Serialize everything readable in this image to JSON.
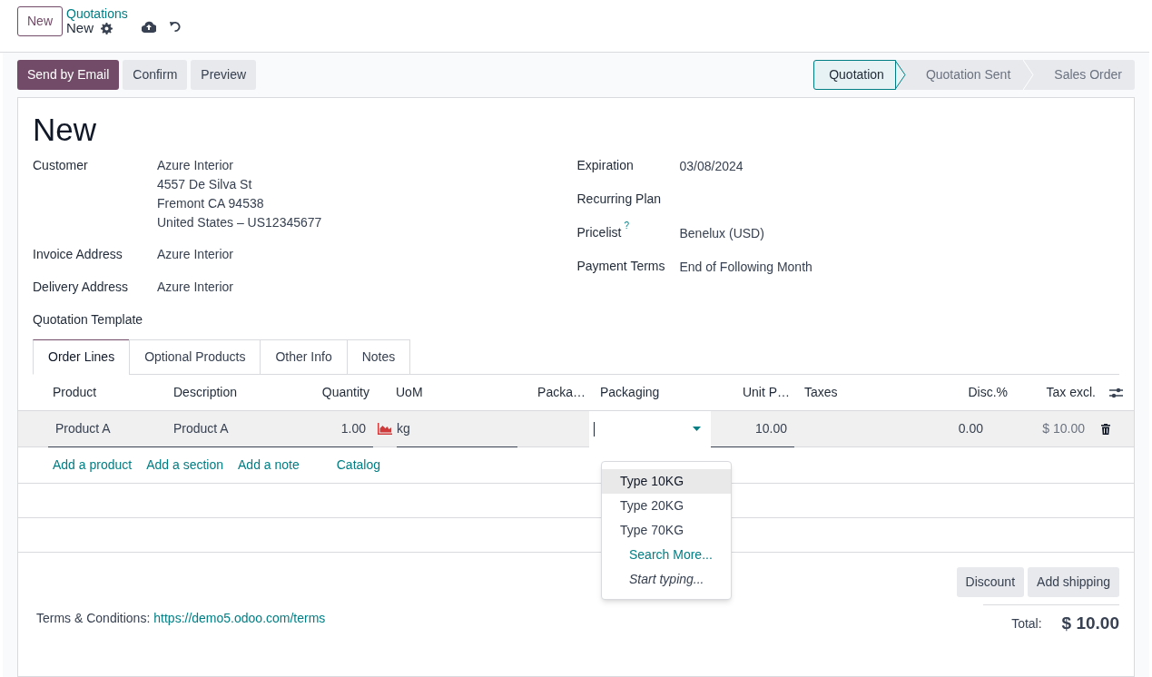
{
  "control_panel": {
    "new_button": "New",
    "breadcrumb": "Quotations",
    "record_title": "New"
  },
  "actions": [
    {
      "label": "Send by Email",
      "primary": true
    },
    {
      "label": "Confirm",
      "primary": false
    },
    {
      "label": "Preview",
      "primary": false
    }
  ],
  "statusbar": [
    {
      "label": "Quotation",
      "selected": true
    },
    {
      "label": "Quotation Sent",
      "selected": false
    },
    {
      "label": "Sales Order",
      "selected": false
    }
  ],
  "title": "New",
  "left_fields": [
    {
      "label": "Customer",
      "lines": [
        "Azure Interior",
        "4557 De Silva St",
        "Fremont CA 94538",
        "United States – US12345677"
      ]
    },
    {
      "label": "Invoice Address",
      "lines": [
        "Azure Interior"
      ]
    },
    {
      "label": "Delivery Address",
      "lines": [
        "Azure Interior"
      ]
    },
    {
      "label": "Quotation Template"
    }
  ],
  "right_fields": [
    {
      "label": "Expiration",
      "value": "03/08/2024"
    },
    {
      "label": "Recurring Plan"
    },
    {
      "label": "Pricelist",
      "help": "?",
      "value": "Benelux (USD)"
    },
    {
      "label": "Payment Terms",
      "value": "End of Following Month"
    }
  ],
  "tabs": [
    {
      "label": "Order Lines",
      "selected": true
    },
    {
      "label": "Optional Products",
      "selected": false
    },
    {
      "label": "Other Info",
      "selected": false
    },
    {
      "label": "Notes",
      "selected": false
    }
  ],
  "table": {
    "columns": [
      "Product",
      "Description",
      "Quantity",
      "UoM",
      "Packa…",
      "Packaging",
      "Unit P…",
      "Taxes",
      "Disc.%",
      "Tax excl."
    ],
    "rows": [
      {
        "product": "Product A",
        "description": "Product A",
        "quantity": "1.00",
        "uom": "kg",
        "unit_price": "10.00",
        "discount": "0.00",
        "subtotal": "$ 10.00"
      }
    ],
    "add_links": [
      "Add a product",
      "Add a section",
      "Add a note",
      "Catalog"
    ]
  },
  "packaging_dropdown": {
    "options": [
      {
        "label": "Type 10KG",
        "selected": true
      },
      {
        "label": "Type 20KG",
        "selected": false
      },
      {
        "label": "Type 70KG",
        "selected": false
      }
    ],
    "search_more": "Search More...",
    "start_typing": "Start typing..."
  },
  "footer": {
    "buttons": [
      "Discount",
      "Add shipping"
    ],
    "terms_label": "Terms & Conditions:",
    "terms_link": "https://demo5.odoo.com/terms",
    "total_label": "Total:",
    "total": "$ 10.00"
  }
}
